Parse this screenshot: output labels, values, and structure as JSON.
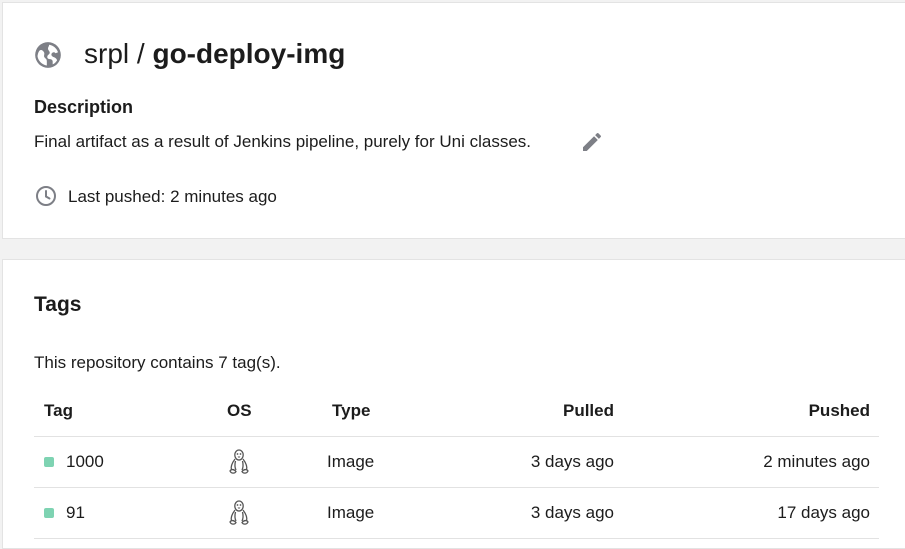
{
  "repository": {
    "namespace": "srpl",
    "separator": "/",
    "name": "go-deploy-img",
    "visibility_icon": "globe-icon",
    "description_heading": "Description",
    "description": "Final artifact as a result of Jenkins pipeline, purely for Uni classes.",
    "edit_icon": "pencil-icon",
    "last_pushed": "Last pushed: 2 minutes ago"
  },
  "tags_section": {
    "heading": "Tags",
    "summary": "This repository contains 7 tag(s).",
    "columns": {
      "tag": "Tag",
      "os": "OS",
      "type": "Type",
      "pulled": "Pulled",
      "pushed": "Pushed"
    },
    "rows": [
      {
        "tag": "1000",
        "os_icon": "linux-icon",
        "type": "Image",
        "pulled": "3 days ago",
        "pushed": "2 minutes ago"
      },
      {
        "tag": "91",
        "os_icon": "linux-icon",
        "type": "Image",
        "pulled": "3 days ago",
        "pushed": "17 days ago"
      }
    ]
  },
  "colors": {
    "tag_dot": "#7ed3b2",
    "icon_gray": "#7d7f86"
  }
}
